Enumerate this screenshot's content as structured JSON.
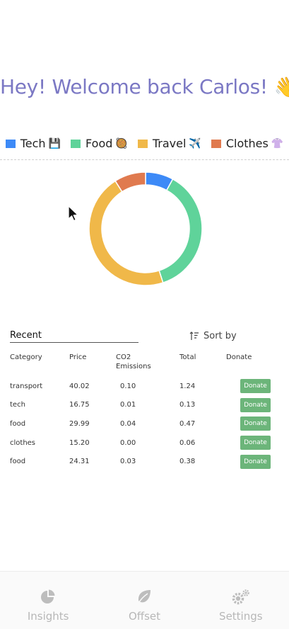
{
  "greeting": "Hey! Welcome back Carlos! 👋",
  "legend": [
    {
      "label": "Tech",
      "emoji": "💾",
      "color": "#3d8af7"
    },
    {
      "label": "Food",
      "emoji": "🥘",
      "color": "#5fd39a"
    },
    {
      "label": "Travel",
      "emoji": "✈️",
      "color": "#f0b849"
    },
    {
      "label": "Clothes",
      "emoji": "👚",
      "color": "#e07a4f"
    }
  ],
  "chart_data": {
    "type": "pie",
    "categories": [
      "Tech",
      "Food",
      "Travel",
      "Clothes"
    ],
    "values": [
      8,
      37,
      46,
      9
    ],
    "colors": [
      "#3d8af7",
      "#5fd39a",
      "#f0b849",
      "#e07a4f"
    ],
    "title": ""
  },
  "recent": {
    "title": "Recent",
    "sort_label": "Sort by",
    "columns": [
      "Category",
      "Price",
      "CO2 Emissions",
      "Total",
      "Donate"
    ],
    "donate_label": "Donate",
    "rows": [
      {
        "category": "transport",
        "price": "40.02",
        "co2": "0.10",
        "total": "1.24"
      },
      {
        "category": "tech",
        "price": "16.75",
        "co2": "0.01",
        "total": "0.13"
      },
      {
        "category": "food",
        "price": "29.99",
        "co2": "0.04",
        "total": "0.47"
      },
      {
        "category": "clothes",
        "price": "15.20",
        "co2": "0.00",
        "total": "0.06"
      },
      {
        "category": "food",
        "price": "24.31",
        "co2": "0.03",
        "total": "0.38"
      }
    ]
  },
  "tabs": [
    {
      "label": "Insights",
      "icon": "pie-chart-icon"
    },
    {
      "label": "Offset",
      "icon": "leaf-icon"
    },
    {
      "label": "Settings",
      "icon": "gears-icon"
    }
  ]
}
